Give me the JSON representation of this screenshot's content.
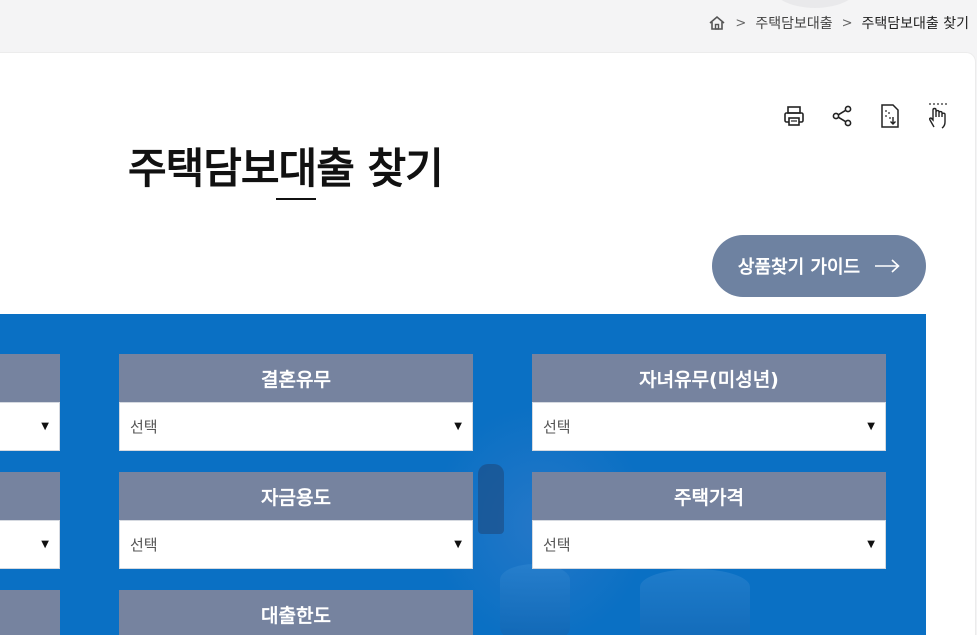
{
  "breadcrumb": {
    "home_icon": "home-icon",
    "items": [
      "주택담보대출",
      "주택담보대출 찾기"
    ]
  },
  "tools": [
    {
      "name": "print-icon"
    },
    {
      "name": "share-icon"
    },
    {
      "name": "download-icon"
    },
    {
      "name": "touch-icon"
    }
  ],
  "page": {
    "title": "주택담보대출 찾기",
    "guide_button": "상품찾기 가이드"
  },
  "filters": {
    "marriage": {
      "label": "결혼유무",
      "value": "선택"
    },
    "children": {
      "label": "자녀유무(미성년)",
      "value": "선택"
    },
    "purpose": {
      "label": "자금용도",
      "value": "선택"
    },
    "house_price": {
      "label": "주택가격",
      "value": "선택"
    },
    "loan_limit": {
      "label": "대출한도"
    }
  },
  "colors": {
    "panel_blue": "#0a70c4",
    "label_slate": "#76839f",
    "button": "#6e82a1"
  }
}
